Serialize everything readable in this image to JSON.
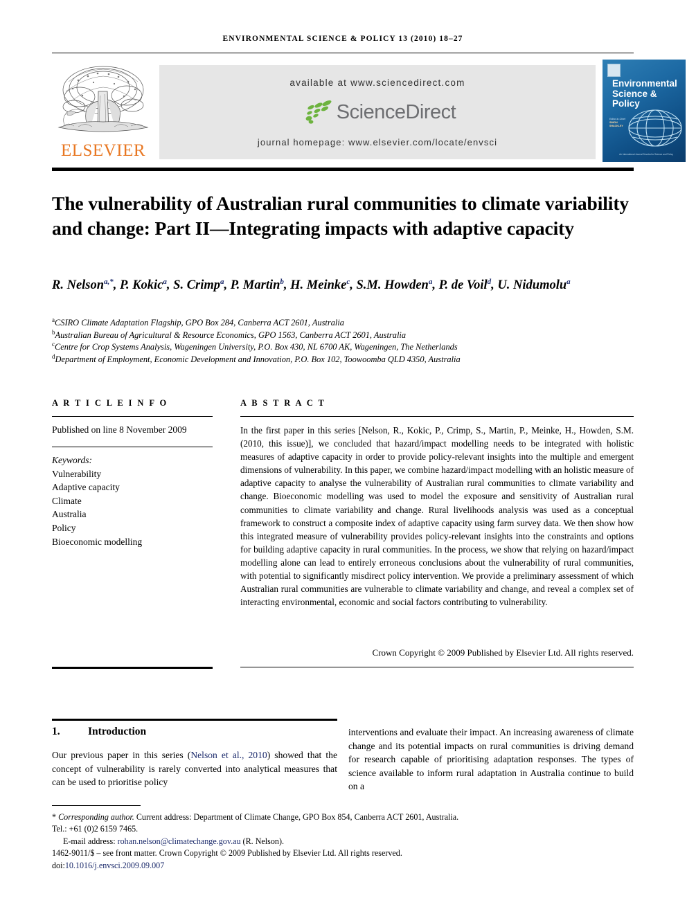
{
  "running_head": "ENVIRONMENTAL SCIENCE & POLICY 13 (2010) 18–27",
  "masthead": {
    "publisher_name": "ELSEVIER",
    "available_at": "available at www.sciencedirect.com",
    "sciencedirect_wordmark": "ScienceDirect",
    "journal_homepage": "journal homepage: www.elsevier.com/locate/envsci",
    "cover": {
      "title": "Environmental Science & Policy",
      "editor_label": "Editor-in-Chief",
      "editor_name": "SIMON SHACKLEY",
      "footer": "An International Journal Devoted to Science and Policy"
    }
  },
  "article": {
    "title": "The vulnerability of Australian rural communities to climate variability and change: Part II—Integrating impacts with adaptive capacity",
    "authors": [
      {
        "name": "R. Nelson",
        "marks": "a,*"
      },
      {
        "name": "P. Kokic",
        "marks": "a"
      },
      {
        "name": "S. Crimp",
        "marks": "a"
      },
      {
        "name": "P. Martin",
        "marks": "b"
      },
      {
        "name": "H. Meinke",
        "marks": "c"
      },
      {
        "name": "S.M. Howden",
        "marks": "a"
      },
      {
        "name": "P. de Voil",
        "marks": "d"
      },
      {
        "name": "U. Nidumolu",
        "marks": "a"
      }
    ],
    "affiliations": [
      {
        "mark": "a",
        "text": "CSIRO Climate Adaptation Flagship, GPO Box 284, Canberra ACT 2601, Australia"
      },
      {
        "mark": "b",
        "text": "Australian Bureau of Agricultural & Resource Economics, GPO 1563, Canberra ACT 2601, Australia"
      },
      {
        "mark": "c",
        "text": "Centre for Crop Systems Analysis, Wageningen University, P.O. Box 430, NL 6700 AK, Wageningen, The Netherlands"
      },
      {
        "mark": "d",
        "text": "Department of Employment, Economic Development and Innovation, P.O. Box 102, Toowoomba QLD 4350, Australia"
      }
    ]
  },
  "article_info": {
    "heading": "A R T I C L E   I N F O",
    "published": "Published on line 8 November 2009",
    "keywords_label": "Keywords:",
    "keywords": [
      "Vulnerability",
      "Adaptive capacity",
      "Climate",
      "Australia",
      "Policy",
      "Bioeconomic modelling"
    ]
  },
  "abstract": {
    "heading": "A B S T R A C T",
    "text": "In the first paper in this series [Nelson, R., Kokic, P., Crimp, S., Martin, P., Meinke, H., Howden, S.M. (2010, this issue)], we concluded that hazard/impact modelling needs to be integrated with holistic measures of adaptive capacity in order to provide policy-relevant insights into the multiple and emergent dimensions of vulnerability. In this paper, we combine hazard/impact modelling with an holistic measure of adaptive capacity to analyse the vulnerability of Australian rural communities to climate variability and change. Bioeconomic modelling was used to model the exposure and sensitivity of Australian rural communities to climate variability and change. Rural livelihoods analysis was used as a conceptual framework to construct a composite index of adaptive capacity using farm survey data. We then show how this integrated measure of vulnerability provides policy-relevant insights into the constraints and options for building adaptive capacity in rural communities. In the process, we show that relying on hazard/impact modelling alone can lead to entirely erroneous conclusions about the vulnerability of rural communities, with potential to significantly misdirect policy intervention. We provide a preliminary assessment of which Australian rural communities are vulnerable to climate variability and change, and reveal a complex set of interacting environmental, economic and social factors contributing to vulnerability.",
    "copyright": "Crown Copyright © 2009 Published by Elsevier Ltd. All rights reserved."
  },
  "introduction": {
    "number": "1.",
    "heading": "Introduction",
    "left_before_cite": "Our previous paper in this series (",
    "citation": "Nelson et al., 2010",
    "left_after_cite": ") showed that the concept of vulnerability is rarely converted into analytical measures that can be used to prioritise policy",
    "right_text": "interventions and evaluate their impact. An increasing awareness of climate change and its potential impacts on rural communities is driving demand for research capable of prioritising adaptation responses. The types of science available to inform rural adaptation in Australia continue to build on a"
  },
  "footnotes": {
    "corresponding_marker": "*",
    "corresponding_label": "Corresponding author.",
    "corresponding_address": " Current address: Department of Climate Change, GPO Box 854, Canberra ACT 2601, Australia.",
    "tel": "Tel.: +61 (0)2 6159 7465.",
    "email_label": "E-mail address:",
    "email": "rohan.nelson@climatechange.gov.au",
    "email_suffix": "(R. Nelson).",
    "issn_line": "1462-9011/$ – see front matter. Crown Copyright © 2009 Published by Elsevier Ltd. All rights reserved.",
    "doi_label": "doi:",
    "doi": "10.1016/j.envsci.2009.09.007"
  },
  "colors": {
    "elsevier_orange": "#E87722",
    "sciencedirect_green": "#6DB33F",
    "sciencedirect_gray": "#6d6e71",
    "link_blue": "#1b2a6b",
    "band_gray": "#e6e6e6"
  }
}
